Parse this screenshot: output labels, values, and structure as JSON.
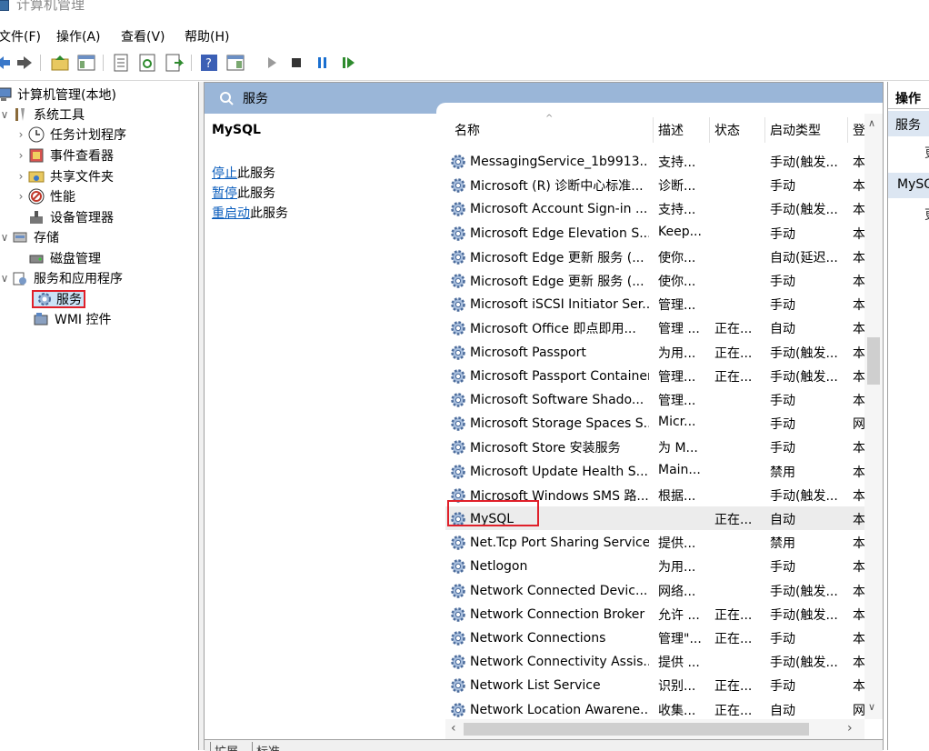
{
  "window": {
    "title": "计算机管理"
  },
  "menu": [
    "文件(F)",
    "操作(A)",
    "查看(V)",
    "帮助(H)"
  ],
  "tree": {
    "root": "计算机管理(本地)",
    "system_tools": "系统工具",
    "task_scheduler": "任务计划程序",
    "event_viewer": "事件查看器",
    "shared_folders": "共享文件夹",
    "performance": "性能",
    "device_manager": "设备管理器",
    "storage": "存储",
    "disk_management": "磁盘管理",
    "services_apps": "服务和应用程序",
    "services": "服务",
    "wmi": "WMI 控件"
  },
  "panel": {
    "header": "服务",
    "selected_service": "MySQL",
    "actions": [
      {
        "link": "停止",
        "rest": "此服务"
      },
      {
        "link": "暂停",
        "rest": "此服务"
      },
      {
        "link": "重启动",
        "rest": "此服务"
      }
    ]
  },
  "columns": {
    "name": "名称",
    "desc": "描述",
    "state": "状态",
    "start": "启动类型",
    "log": "登"
  },
  "rows": [
    {
      "name": "MessagingService_1b9913...",
      "desc": "支持...",
      "state": "",
      "start": "手动(触发...",
      "log": "本"
    },
    {
      "name": "Microsoft (R) 诊断中心标准...",
      "desc": "诊断...",
      "state": "",
      "start": "手动",
      "log": "本"
    },
    {
      "name": "Microsoft Account Sign-in ...",
      "desc": "支持...",
      "state": "",
      "start": "手动(触发...",
      "log": "本"
    },
    {
      "name": "Microsoft Edge Elevation S...",
      "desc": "Keep...",
      "state": "",
      "start": "手动",
      "log": "本"
    },
    {
      "name": "Microsoft Edge 更新 服务 (...",
      "desc": "使你...",
      "state": "",
      "start": "自动(延迟...",
      "log": "本"
    },
    {
      "name": "Microsoft Edge 更新 服务 (...",
      "desc": "使你...",
      "state": "",
      "start": "手动",
      "log": "本"
    },
    {
      "name": "Microsoft iSCSI Initiator Ser...",
      "desc": "管理...",
      "state": "",
      "start": "手动",
      "log": "本"
    },
    {
      "name": "Microsoft Office 即点即用...",
      "desc": "管理 ...",
      "state": "正在...",
      "start": "自动",
      "log": "本"
    },
    {
      "name": "Microsoft Passport",
      "desc": "为用...",
      "state": "正在...",
      "start": "手动(触发...",
      "log": "本"
    },
    {
      "name": "Microsoft Passport Container",
      "desc": "管理...",
      "state": "正在...",
      "start": "手动(触发...",
      "log": "本"
    },
    {
      "name": "Microsoft Software Shado...",
      "desc": "管理...",
      "state": "",
      "start": "手动",
      "log": "本"
    },
    {
      "name": "Microsoft Storage Spaces S...",
      "desc": "Micr...",
      "state": "",
      "start": "手动",
      "log": "网"
    },
    {
      "name": "Microsoft Store 安装服务",
      "desc": "为 M...",
      "state": "",
      "start": "手动",
      "log": "本"
    },
    {
      "name": "Microsoft Update Health S...",
      "desc": "Main...",
      "state": "",
      "start": "禁用",
      "log": "本"
    },
    {
      "name": "Microsoft Windows SMS 路...",
      "desc": "根据...",
      "state": "",
      "start": "手动(触发...",
      "log": "本"
    },
    {
      "name": "MySQL",
      "desc": "",
      "state": "正在...",
      "start": "自动",
      "log": "本"
    },
    {
      "name": "Net.Tcp Port Sharing Service",
      "desc": "提供...",
      "state": "",
      "start": "禁用",
      "log": "本"
    },
    {
      "name": "Netlogon",
      "desc": "为用...",
      "state": "",
      "start": "手动",
      "log": "本"
    },
    {
      "name": "Network Connected Devic...",
      "desc": "网络...",
      "state": "",
      "start": "手动(触发...",
      "log": "本"
    },
    {
      "name": "Network Connection Broker",
      "desc": "允许 ...",
      "state": "正在...",
      "start": "手动(触发...",
      "log": "本"
    },
    {
      "name": "Network Connections",
      "desc": "管理\"...",
      "state": "正在...",
      "start": "手动",
      "log": "本"
    },
    {
      "name": "Network Connectivity Assis...",
      "desc": "提供 ...",
      "state": "",
      "start": "手动(触发...",
      "log": "本"
    },
    {
      "name": "Network List Service",
      "desc": "识别...",
      "state": "正在...",
      "start": "手动",
      "log": "本"
    },
    {
      "name": "Network Location Awarene...",
      "desc": "收集...",
      "state": "正在...",
      "start": "自动",
      "log": "网"
    }
  ],
  "bottom_tabs": [
    "扩展",
    "标准"
  ],
  "actions_pane": {
    "header": "操作",
    "section1": "服务",
    "section2": "MySQL",
    "item": "更"
  }
}
